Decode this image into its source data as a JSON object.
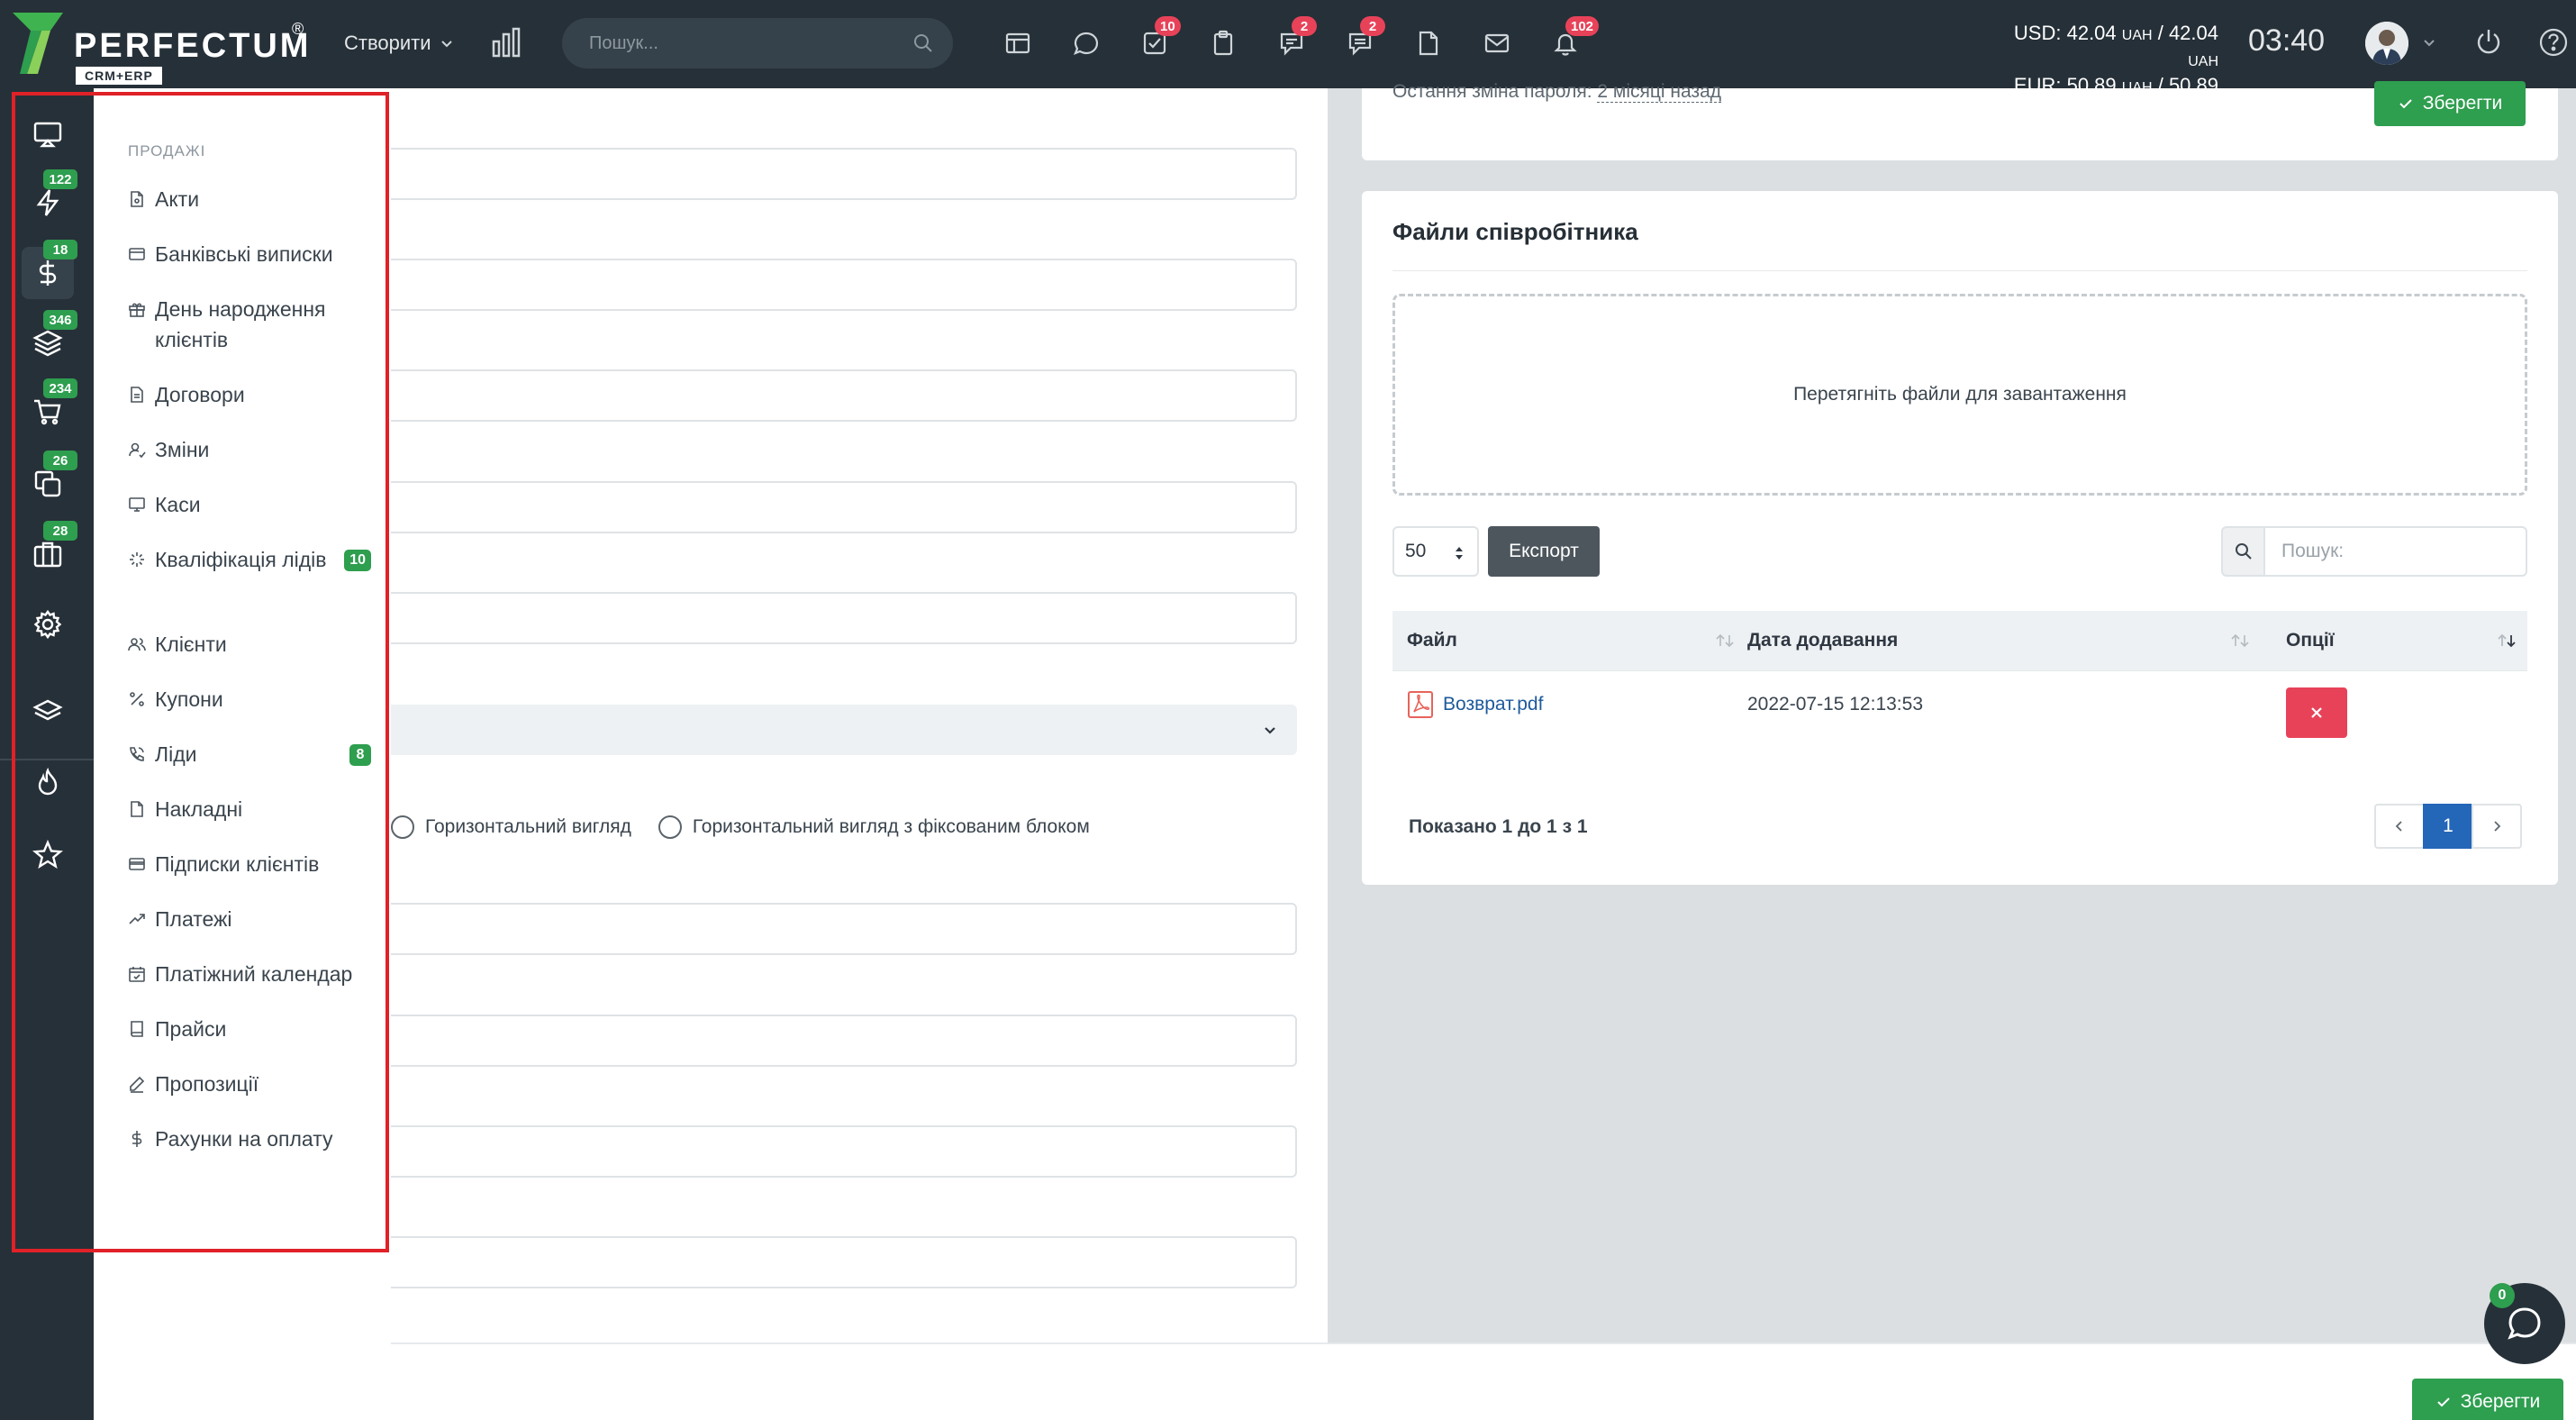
{
  "topbar": {
    "logo_text": "PERFECTUM",
    "logo_sub": "CRM+ERP",
    "logo_reg": "®",
    "create_label": "Створити",
    "search_placeholder": "Пошук...",
    "badges": {
      "tasks": "10",
      "chat": "2",
      "comments": "2",
      "notifications": "102"
    },
    "usd_line": "USD: 42.04",
    "eur_line": "EUR: 50.89",
    "usd_rate2": "42.04",
    "eur_rate2": "50.89",
    "uah": "UAH",
    "sep": "/",
    "time": "03:40"
  },
  "rail": {
    "badges": {
      "activity": "122",
      "finance": "18",
      "products": "346",
      "sales": "234",
      "documents": "26",
      "projects": "28"
    }
  },
  "submenu": {
    "title": "ПРОДАЖІ",
    "items": [
      {
        "label": "Акти",
        "icon": "document-icon"
      },
      {
        "label": "Банківські виписки",
        "icon": "card-icon"
      },
      {
        "label": "День народження клієнтів",
        "icon": "gift-icon"
      },
      {
        "label": "Договори",
        "icon": "document-icon"
      },
      {
        "label": "Зміни",
        "icon": "user-shift-icon"
      },
      {
        "label": "Каси",
        "icon": "monitor-icon"
      },
      {
        "label": "Кваліфікація лідів",
        "icon": "spinner-icon",
        "badge": "10"
      },
      {
        "label": "Клієнти",
        "icon": "users-icon"
      },
      {
        "label": "Купони",
        "icon": "percent-icon"
      },
      {
        "label": "Ліди",
        "icon": "phone-icon",
        "badge": "8"
      },
      {
        "label": "Накладні",
        "icon": "file-icon"
      },
      {
        "label": "Підписки клієнтів",
        "icon": "card-icon"
      },
      {
        "label": "Платежі",
        "icon": "trend-icon"
      },
      {
        "label": "Платіжний календар",
        "icon": "calendar-icon"
      },
      {
        "label": "Прайси",
        "icon": "book-icon"
      },
      {
        "label": "Пропозиції",
        "icon": "pen-icon"
      },
      {
        "label": "Рахунки на оплату",
        "icon": "dollar-icon"
      }
    ]
  },
  "form": {
    "radio_horizontal": "Горизонтальний вигляд",
    "radio_horizontal_fixed": "Горизонтальний вигляд з фіксованим блоком"
  },
  "password": {
    "text": "Остання зміна пароля:",
    "ago": "2 місяці назад",
    "save_label": "Зберегти"
  },
  "files": {
    "title": "Файли співробітника",
    "dropzone_text": "Перетягніть файли для завантаження",
    "page_size": "50",
    "export_label": "Експорт",
    "search_placeholder": "Пошук:",
    "columns": {
      "file": "Файл",
      "date": "Дата додавання",
      "options": "Опції"
    },
    "rows": [
      {
        "name": "Возврат.pdf",
        "date": "2022-07-15 12:13:53"
      }
    ],
    "shown": "Показано 1 до 1 з 1",
    "pages": [
      "1"
    ]
  },
  "bottom": {
    "save_label": "Зберегти"
  },
  "chat": {
    "badge": "0"
  },
  "colors": {
    "dark": "#263038",
    "accent_green": "#2e9e4f",
    "badge_red": "#e84259",
    "link_blue": "#1d5a9c",
    "page_active": "#2466b8",
    "highlight_frame": "#e02128"
  }
}
